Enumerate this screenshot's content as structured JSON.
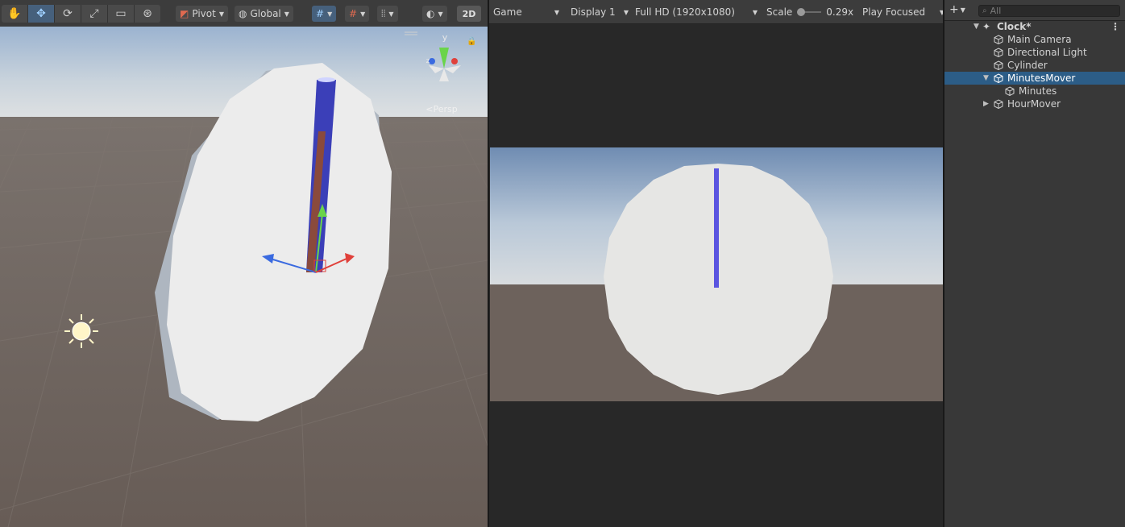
{
  "scene": {
    "toolbar": {
      "pivot_label": "Pivot",
      "global_label": "Global",
      "two_d_label": "2D"
    },
    "gizmo": {
      "axis_y": "y",
      "axis_z": "z",
      "persp_label": "<Persp"
    }
  },
  "game": {
    "toolbar": {
      "mode": "Game",
      "display": "Display 1",
      "resolution": "Full HD (1920x1080)",
      "scale_label": "Scale",
      "scale_value": "0.29x",
      "play_mode": "Play Focused"
    }
  },
  "hierarchy": {
    "search_placeholder": "All",
    "add_label": "+",
    "scene_name": "Clock*",
    "items": [
      {
        "label": "Main Camera"
      },
      {
        "label": "Directional Light"
      },
      {
        "label": "Cylinder"
      },
      {
        "label": "MinutesMover"
      },
      {
        "label": "Minutes"
      },
      {
        "label": "HourMover"
      }
    ]
  },
  "colors": {
    "selection": "#2c5d87",
    "accent_tool": "#46607c",
    "axis_x": "#e0403a",
    "axis_y": "#6ad44a",
    "axis_z": "#3a6ae0",
    "minute_hand": "#5a55e0"
  }
}
